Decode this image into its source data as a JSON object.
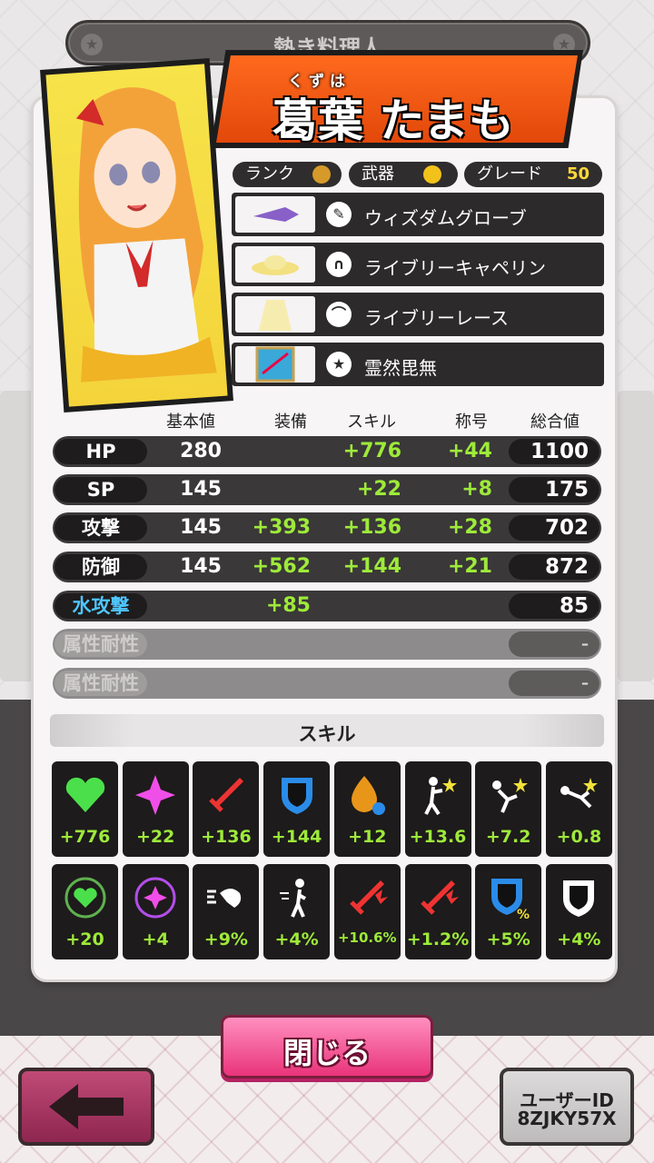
{
  "header": {
    "title": "熱き料理人"
  },
  "character": {
    "ruby": "くずは",
    "name": "葛葉 たまも"
  },
  "chips": {
    "rank_label": "ランク",
    "weapon_label": "武器",
    "grade_label": "グレード",
    "grade_value": "50"
  },
  "equipment": [
    {
      "name": "ウィズダムグローブ",
      "icon": "glove-icon"
    },
    {
      "name": "ライブリーキャペリン",
      "icon": "headphones-icon"
    },
    {
      "name": "ライブリーレース",
      "icon": "cape-icon"
    },
    {
      "name": "霊然毘無",
      "icon": "star-icon"
    }
  ],
  "stats": {
    "headers": [
      "基本値",
      "装備",
      "スキル",
      "称号",
      "総合値"
    ],
    "rows": [
      {
        "label": "HP",
        "base": "280",
        "equip": "",
        "skill": "+776",
        "title": "+44",
        "total": "1100"
      },
      {
        "label": "SP",
        "base": "145",
        "equip": "",
        "skill": "+22",
        "title": "+8",
        "total": "175"
      },
      {
        "label": "攻撃",
        "base": "145",
        "equip": "+393",
        "skill": "+136",
        "title": "+28",
        "total": "702"
      },
      {
        "label": "防御",
        "base": "145",
        "equip": "+562",
        "skill": "+144",
        "title": "+21",
        "total": "872"
      },
      {
        "label": "水攻撃",
        "base": "",
        "equip": "+85",
        "skill": "",
        "title": "",
        "total": "85"
      },
      {
        "label": "属性耐性",
        "base": "",
        "equip": "",
        "skill": "",
        "title": "",
        "total": "–"
      },
      {
        "label": "属性耐性",
        "base": "",
        "equip": "",
        "skill": "",
        "title": "",
        "total": "–"
      }
    ]
  },
  "skills": {
    "title": "スキル",
    "row1": [
      {
        "icon": "heart-icon",
        "value": "+776"
      },
      {
        "icon": "sparkle-icon",
        "value": "+22"
      },
      {
        "icon": "sword-icon",
        "value": "+136"
      },
      {
        "icon": "shield-icon",
        "value": "+144"
      },
      {
        "icon": "flame-drop-icon",
        "value": "+12"
      },
      {
        "icon": "figure-icon",
        "value": "+13.6"
      },
      {
        "icon": "kick-icon",
        "value": "+7.2"
      },
      {
        "icon": "fall-icon",
        "value": "+0.8"
      }
    ],
    "row2": [
      {
        "icon": "heart-ring-icon",
        "value": "+20"
      },
      {
        "icon": "sparkle-ring-icon",
        "value": "+4"
      },
      {
        "icon": "dash-icon",
        "value": "+9%"
      },
      {
        "icon": "run-icon",
        "value": "+4%"
      },
      {
        "icon": "crit-sword-icon",
        "value": "+10.6%"
      },
      {
        "icon": "crit-sword-icon",
        "value": "+1.2%"
      },
      {
        "icon": "shield-percent-icon",
        "value": "+5%"
      },
      {
        "icon": "white-shield-icon",
        "value": "+4%"
      }
    ]
  },
  "buttons": {
    "close": "閉じる",
    "user_id_label": "ユーザーID",
    "user_id": "8ZJKY57X"
  },
  "colors": {
    "accent_orange": "#ff6a1e",
    "green_value": "#9eea3a",
    "pink_button": "#e9347a"
  }
}
